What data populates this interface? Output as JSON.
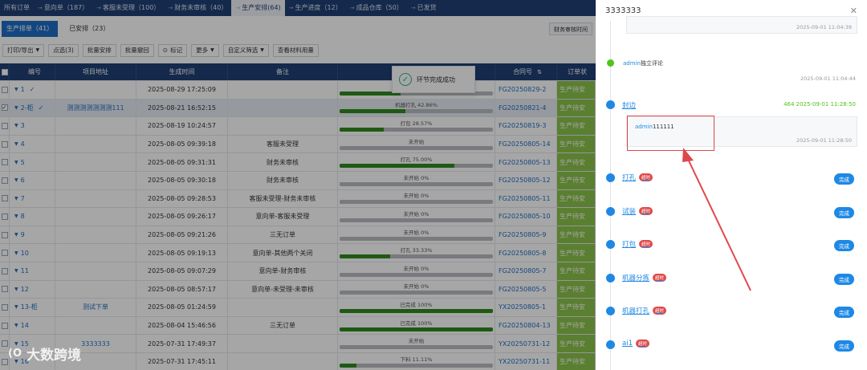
{
  "nav": {
    "items": [
      {
        "label": "所有订单",
        "arrow": false
      },
      {
        "label": "意向单（187）",
        "arrow": true
      },
      {
        "label": "客服未受理（100）",
        "arrow": true
      },
      {
        "label": "财务未审核（40）",
        "arrow": true
      },
      {
        "label": "生产安排(64)",
        "arrow": true,
        "active": true
      },
      {
        "label": "生产进度（12）",
        "arrow": true
      },
      {
        "label": "成品仓库（50）",
        "arrow": true
      },
      {
        "label": "已发货",
        "arrow": true
      }
    ]
  },
  "subtabs": {
    "scheduling": "生产排单（41）",
    "scheduled": "已安排（23）",
    "audit_time": "财务审核时间"
  },
  "toolbar": {
    "print_export": "打印/导出",
    "selected": "点选(3)",
    "batch_arrange": "批量安排",
    "batch_withdraw": "批量撤回",
    "mark": "标记",
    "more": "更多",
    "custom_filter": "自定义筛选",
    "view_materials": "查看材料用量"
  },
  "table": {
    "headers": {
      "no": "编号",
      "address": "项目地址",
      "created": "生成时间",
      "note": "备注",
      "progress": "",
      "contract": "合同号",
      "status": "订单状"
    },
    "rows": [
      {
        "no": "1",
        "address": "",
        "time": "2025-08-29 17:25:09",
        "note": "",
        "progress_label": "",
        "progress": 0.4,
        "contract": "FG20250829-2",
        "status": "生产待安",
        "checked": false,
        "selected": false,
        "done_check": true
      },
      {
        "no": "2-柜",
        "address": "测测测测测测测111",
        "time": "2025-08-21 16:52:15",
        "note": "",
        "progress_label": "机器打孔 42.86%",
        "progress": 0.43,
        "contract": "FG20250821-4",
        "status": "生产待安",
        "checked": true,
        "selected": true,
        "done_check": true
      },
      {
        "no": "3",
        "address": "",
        "time": "2025-08-19 10:24:57",
        "note": "",
        "progress_label": "打包 28.57%",
        "progress": 0.29,
        "contract": "FG20250819-3",
        "status": "生产待安",
        "checked": false,
        "selected": false
      },
      {
        "no": "4",
        "address": "",
        "time": "2025-08-05 09:39:18",
        "note": "客服未受理",
        "progress_label": "未开始",
        "progress": 0,
        "contract": "FG20250805-14",
        "status": "生产待安",
        "checked": false,
        "selected": false
      },
      {
        "no": "5",
        "address": "",
        "time": "2025-08-05 09:31:31",
        "note": "财务未审核",
        "progress_label": "打孔 75.00%",
        "progress": 0.75,
        "contract": "FG20250805-13",
        "status": "生产待安",
        "checked": false,
        "selected": false
      },
      {
        "no": "6",
        "address": "",
        "time": "2025-08-05 09:30:18",
        "note": "财务未审核",
        "progress_label": "未开始 0%",
        "progress": 0,
        "contract": "FG20250805-12",
        "status": "生产待安",
        "checked": false,
        "selected": false
      },
      {
        "no": "7",
        "address": "",
        "time": "2025-08-05 09:28:53",
        "note": "客服未受理-财务未审核",
        "progress_label": "未开始 0%",
        "progress": 0,
        "contract": "FG20250805-11",
        "status": "生产待安",
        "checked": false,
        "selected": false
      },
      {
        "no": "8",
        "address": "",
        "time": "2025-08-05 09:26:17",
        "note": "意向单-客服未受理",
        "progress_label": "未开始 0%",
        "progress": 0,
        "contract": "FG20250805-10",
        "status": "生产待安",
        "checked": false,
        "selected": false
      },
      {
        "no": "9",
        "address": "",
        "time": "2025-08-05 09:21:26",
        "note": "三无订单",
        "progress_label": "未开始 0%",
        "progress": 0,
        "contract": "FG20250805-9",
        "status": "生产待安",
        "checked": false,
        "selected": false
      },
      {
        "no": "10",
        "address": "",
        "time": "2025-08-05 09:19:13",
        "note": "意向单-其他两个关闭",
        "progress_label": "打孔 33.33%",
        "progress": 0.33,
        "contract": "FG20250805-8",
        "status": "生产待安",
        "checked": false,
        "selected": false
      },
      {
        "no": "11",
        "address": "",
        "time": "2025-08-05 09:07:29",
        "note": "意向单-财务审核",
        "progress_label": "未开始 0%",
        "progress": 0,
        "contract": "FG20250805-7",
        "status": "生产待安",
        "checked": false,
        "selected": false
      },
      {
        "no": "12",
        "address": "",
        "time": "2025-08-05 08:57:17",
        "note": "意向单-未受理-未审核",
        "progress_label": "未开始 0%",
        "progress": 0,
        "contract": "FG20250805-5",
        "status": "生产待安",
        "checked": false,
        "selected": false
      },
      {
        "no": "13-柜",
        "address": "测试下单",
        "time": "2025-08-05 01:24:59",
        "note": "",
        "progress_label": "已完成 100%",
        "progress": 1.0,
        "contract": "YX20250805-1",
        "status": "生产待安",
        "checked": false,
        "selected": false
      },
      {
        "no": "14",
        "address": "",
        "time": "2025-08-04 15:46:56",
        "note": "三无订单",
        "progress_label": "已完成 100%",
        "progress": 1.0,
        "contract": "FG20250804-13",
        "status": "生产待安",
        "checked": false,
        "selected": false
      },
      {
        "no": "15",
        "address": "3333333",
        "time": "2025-07-31 17:49:37",
        "note": "",
        "progress_label": "未开始",
        "progress": 0,
        "contract": "YX20250731-12",
        "status": "生产待安",
        "checked": false,
        "selected": false
      },
      {
        "no": "16",
        "address": "",
        "time": "2025-07-31 17:45:11",
        "note": "",
        "progress_label": "下料 11.11%",
        "progress": 0.11,
        "contract": "YX20250731-11",
        "status": "生产待安",
        "checked": false,
        "selected": false
      }
    ]
  },
  "toast": {
    "message": "环节完成成功"
  },
  "drawer": {
    "title": "3333333",
    "top_comment_time": "2025-09-01 11:04:39",
    "eval": {
      "user": "admin",
      "text": "独立评论",
      "time": "2025-09-01 11:04:44"
    },
    "edge_step": {
      "label": "封边",
      "meta": "464 2025-09-01 11:28:50"
    },
    "edge_comment": {
      "user": "admin",
      "text": "111111",
      "time": "2025-09-01 11:28:50"
    },
    "steps": [
      {
        "label": "打孔",
        "late": "超时",
        "status": "完成"
      },
      {
        "label": "试装",
        "late": "超时",
        "status": "完成"
      },
      {
        "label": "打包",
        "late": "超时",
        "status": "完成"
      },
      {
        "label": "机器分拣",
        "late": "超时",
        "status": "完成"
      },
      {
        "label": "机器打孔",
        "late": "超时",
        "status": "完成"
      },
      {
        "label": "ai1",
        "late": "超时",
        "status": "完成"
      }
    ]
  },
  "watermark": {
    "logo": "(O",
    "text": "大数跨境"
  }
}
